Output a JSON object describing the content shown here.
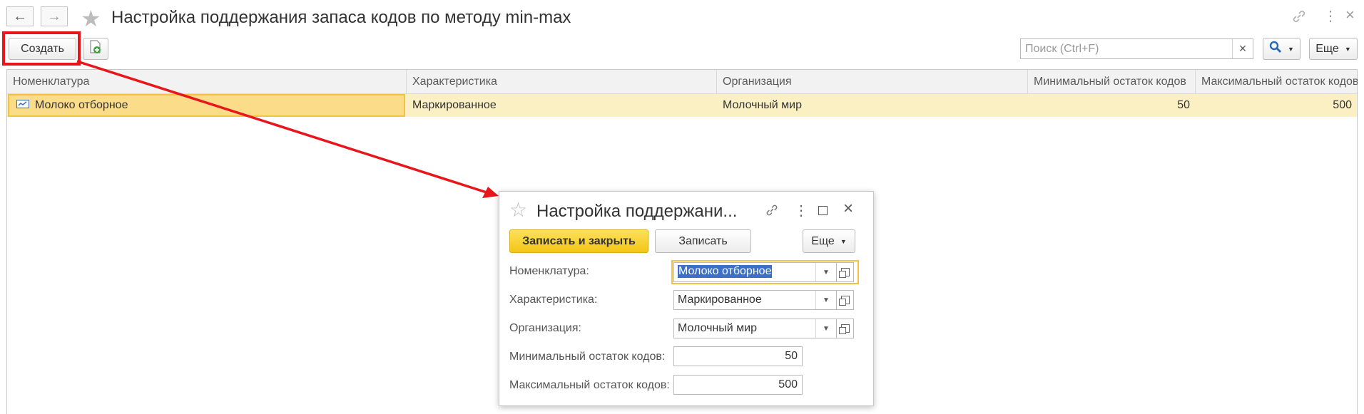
{
  "window": {
    "title": "Настройка поддержания запаса кодов по методу min-max",
    "back_icon": "←",
    "forward_icon": "→",
    "favorite_icon": "★",
    "link_icon": "🔗",
    "more_icon": "⋮",
    "close_icon": "×"
  },
  "toolbar": {
    "create_label": "Создать",
    "search_placeholder": "Поиск (Ctrl+F)",
    "search_clear": "×",
    "search_icon": "🔍",
    "more_label": "Еще"
  },
  "table": {
    "columns": [
      "Номенклатура",
      "Характеристика",
      "Организация",
      "Минимальный остаток кодов",
      "Максимальный остаток кодов"
    ],
    "rows": [
      {
        "nomenclature": "Молоко отборное",
        "characteristic": "Маркированное",
        "organization": "Молочный мир",
        "min": "50",
        "max": "500"
      }
    ]
  },
  "dialog": {
    "title": "Настройка поддержани...",
    "save_close_label": "Записать и закрыть",
    "save_label": "Записать",
    "more_label": "Еще",
    "fields": {
      "nomenclature": {
        "label": "Номенклатура:",
        "value": "Молоко отборное"
      },
      "characteristic": {
        "label": "Характеристика:",
        "value": "Маркированное"
      },
      "organization": {
        "label": "Организация:",
        "value": "Молочный мир"
      },
      "min": {
        "label": "Минимальный остаток кодов:",
        "value": "50"
      },
      "max": {
        "label": "Максимальный остаток кодов:",
        "value": "500"
      }
    }
  },
  "colors": {
    "accent_yellow": "#f7d534",
    "selection_row": "#fbf0c4",
    "annotation_red": "#e8161b",
    "text_highlight": "#3b6fc8"
  }
}
